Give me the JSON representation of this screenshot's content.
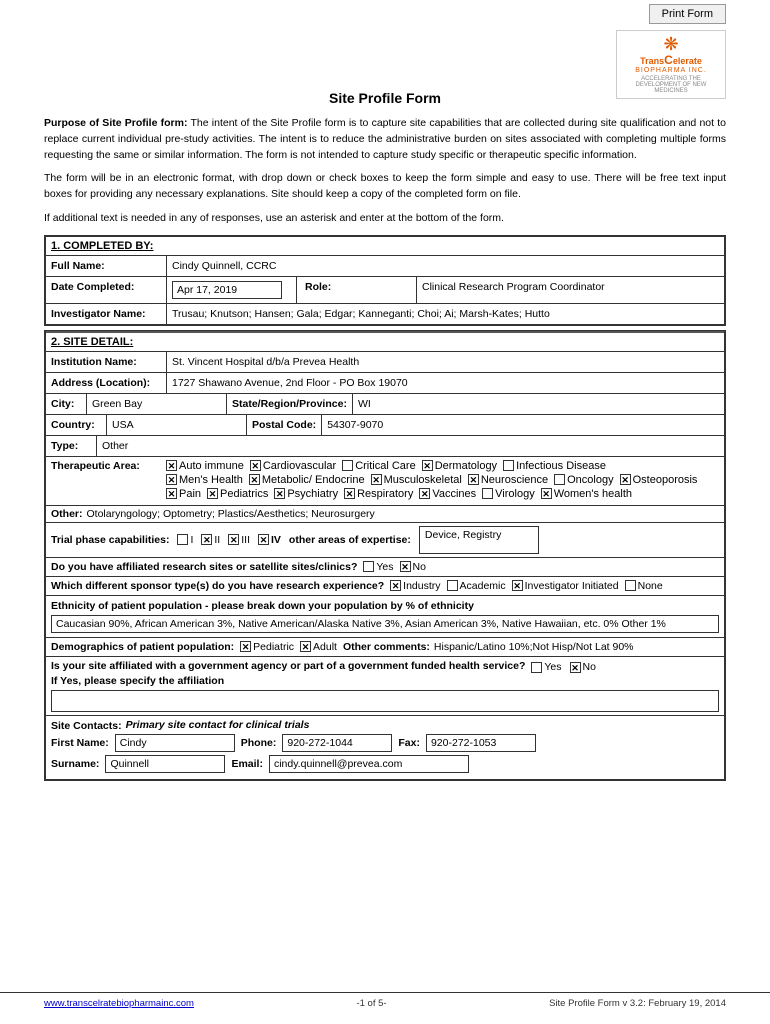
{
  "header": {
    "print_form_label": "Print Form"
  },
  "logo": {
    "icon": "❋",
    "name_line1": "Trans",
    "name_line2": "Celerate",
    "name_biopharma": "BIOPHARMA INC.",
    "tagline": "ACCELERATING THE DEVELOPMENT OF NEW MEDICINES"
  },
  "form": {
    "title": "Site Profile Form",
    "intro1": "The intent of the Site Profile form is to capture site capabilities that are collected during site qualification and not to replace current individual pre-study activities. The intent is to reduce the administrative burden on sites associated with completing multiple forms requesting the same or similar information.  The form is not intended to capture study specific or therapeutic specific information.",
    "intro1_bold": "Purpose of Site Profile form:",
    "intro2": "The form will be in an electronic format, with drop down or check boxes to keep the form simple and easy to use. There will be free text input boxes for providing any necessary explanations. Site  should keep a copy of the completed form on file.",
    "intro3": "If additional text is needed in any of responses, use an asterisk and enter at the bottom of the form.",
    "section1_header": "1. COMPLETED BY:",
    "full_name_label": "Full Name:",
    "full_name_value": "Cindy Quinnell, CCRC",
    "date_label": "Date Completed:",
    "date_value": "Apr 17, 2019",
    "role_label": "Role:",
    "role_value": "Clinical Research Program Coordinator",
    "investigator_label": "Investigator Name:",
    "investigator_value": "Trusau; Knutson; Hansen; Gala; Edgar; Kanneganti; Choi; Ai; Marsh-Kates; Hutto",
    "section2_header": "2. SITE DETAIL:",
    "institution_label": "Institution Name:",
    "institution_value": "St. Vincent Hospital d/b/a Prevea Health",
    "address_label": "Address (Location):",
    "address_value": "1727 Shawano Avenue, 2nd Floor - PO Box 19070",
    "city_label": "City:",
    "city_value": "Green Bay",
    "state_label": "State/Region/Province:",
    "state_value": "WI",
    "country_label": "Country:",
    "country_value": "USA",
    "postal_label": "Postal Code:",
    "postal_value": "54307-9070",
    "type_label": "Type:",
    "type_value": "Other",
    "therapeutic_label": "Therapeutic Area:",
    "therapeutic_items": [
      {
        "label": "Auto immune",
        "checked": true
      },
      {
        "label": "Cardiovascular",
        "checked": true
      },
      {
        "label": "Critical Care",
        "checked": false
      },
      {
        "label": "Dermatology",
        "checked": true
      },
      {
        "label": "Infectious Disease",
        "checked": false
      },
      {
        "label": "Men's Health",
        "checked": true
      },
      {
        "label": "Metabolic/ Endocrine",
        "checked": true
      },
      {
        "label": "Musculoskeletal",
        "checked": true
      },
      {
        "label": "Neuroscience",
        "checked": true
      },
      {
        "label": "Oncology",
        "checked": false
      },
      {
        "label": "Osteoporosis",
        "checked": true
      },
      {
        "label": "Pain",
        "checked": true
      },
      {
        "label": "Pediatrics",
        "checked": true
      },
      {
        "label": "Psychiatry",
        "checked": true
      },
      {
        "label": "Respiratory",
        "checked": true
      },
      {
        "label": "Vaccines",
        "checked": true
      },
      {
        "label": "Virology",
        "checked": false
      },
      {
        "label": "Women's health",
        "checked": true
      }
    ],
    "other_label": "Other:",
    "other_value": "Otolaryngology; Optometry; Plastics/Aesthetics; Neurosurgery",
    "trial_phase_label": "Trial phase capabilities:",
    "phases": [
      {
        "label": "I",
        "checked": false
      },
      {
        "label": "II",
        "checked": true
      },
      {
        "label": "III",
        "checked": true
      },
      {
        "label": "IV",
        "checked": true
      }
    ],
    "other_expertise_label": "other areas of expertise:",
    "other_expertise_value": "Device, Registry",
    "satellite_label": "Do you have affiliated research sites or satellite sites/clinics?",
    "satellite_yes": "Yes",
    "satellite_no": "No",
    "satellite_checked": "no",
    "sponsor_label": "Which different sponsor type(s) do you have research experience?",
    "sponsor_items": [
      {
        "label": "Industry",
        "checked": true
      },
      {
        "label": "Academic",
        "checked": false
      },
      {
        "label": "Investigator Initiated",
        "checked": true
      },
      {
        "label": "None",
        "checked": false
      }
    ],
    "ethnicity_header": "Ethnicity of patient population - please break down your population by % of ethnicity",
    "ethnicity_value": "Caucasian 90%, African American 3%, Native American/Alaska Native 3%, Asian American 3%, Native Hawaiian, etc. 0% Other 1%",
    "demographics_label": "Demographics of patient population:",
    "demo_items": [
      {
        "label": "Pediatric",
        "checked": true
      },
      {
        "label": "Adult",
        "checked": true
      }
    ],
    "other_comments_label": "Other comments:",
    "other_comments_value": "Hispanic/Latino 10%;Not Hisp/Not Lat 90%",
    "govt_question": "Is your site affiliated with a government agency or part of a government funded health service?",
    "govt_yes_label": "Yes",
    "govt_no_label": "No",
    "govt_checked": "no",
    "govt_if_yes": "If Yes, please specify the affiliation",
    "govt_affil_value": "",
    "site_contacts_label": "Site Contacts:",
    "site_contacts_sub": "Primary site contact for clinical trials",
    "first_name_label": "First Name:",
    "first_name_value": "Cindy",
    "phone_label": "Phone:",
    "phone_value": "920-272-1044",
    "fax_label": "Fax:",
    "fax_value": "920-272-1053",
    "surname_label": "Surname:",
    "surname_value": "Quinnell",
    "email_label": "Email:",
    "email_value": "cindy.quinnell@prevea.com"
  },
  "footer": {
    "website": "www.transcelratebiopharmainc.com",
    "page": "-1 of 5-",
    "version": "Site Profile Form v 3.2:  February 19, 2014"
  }
}
